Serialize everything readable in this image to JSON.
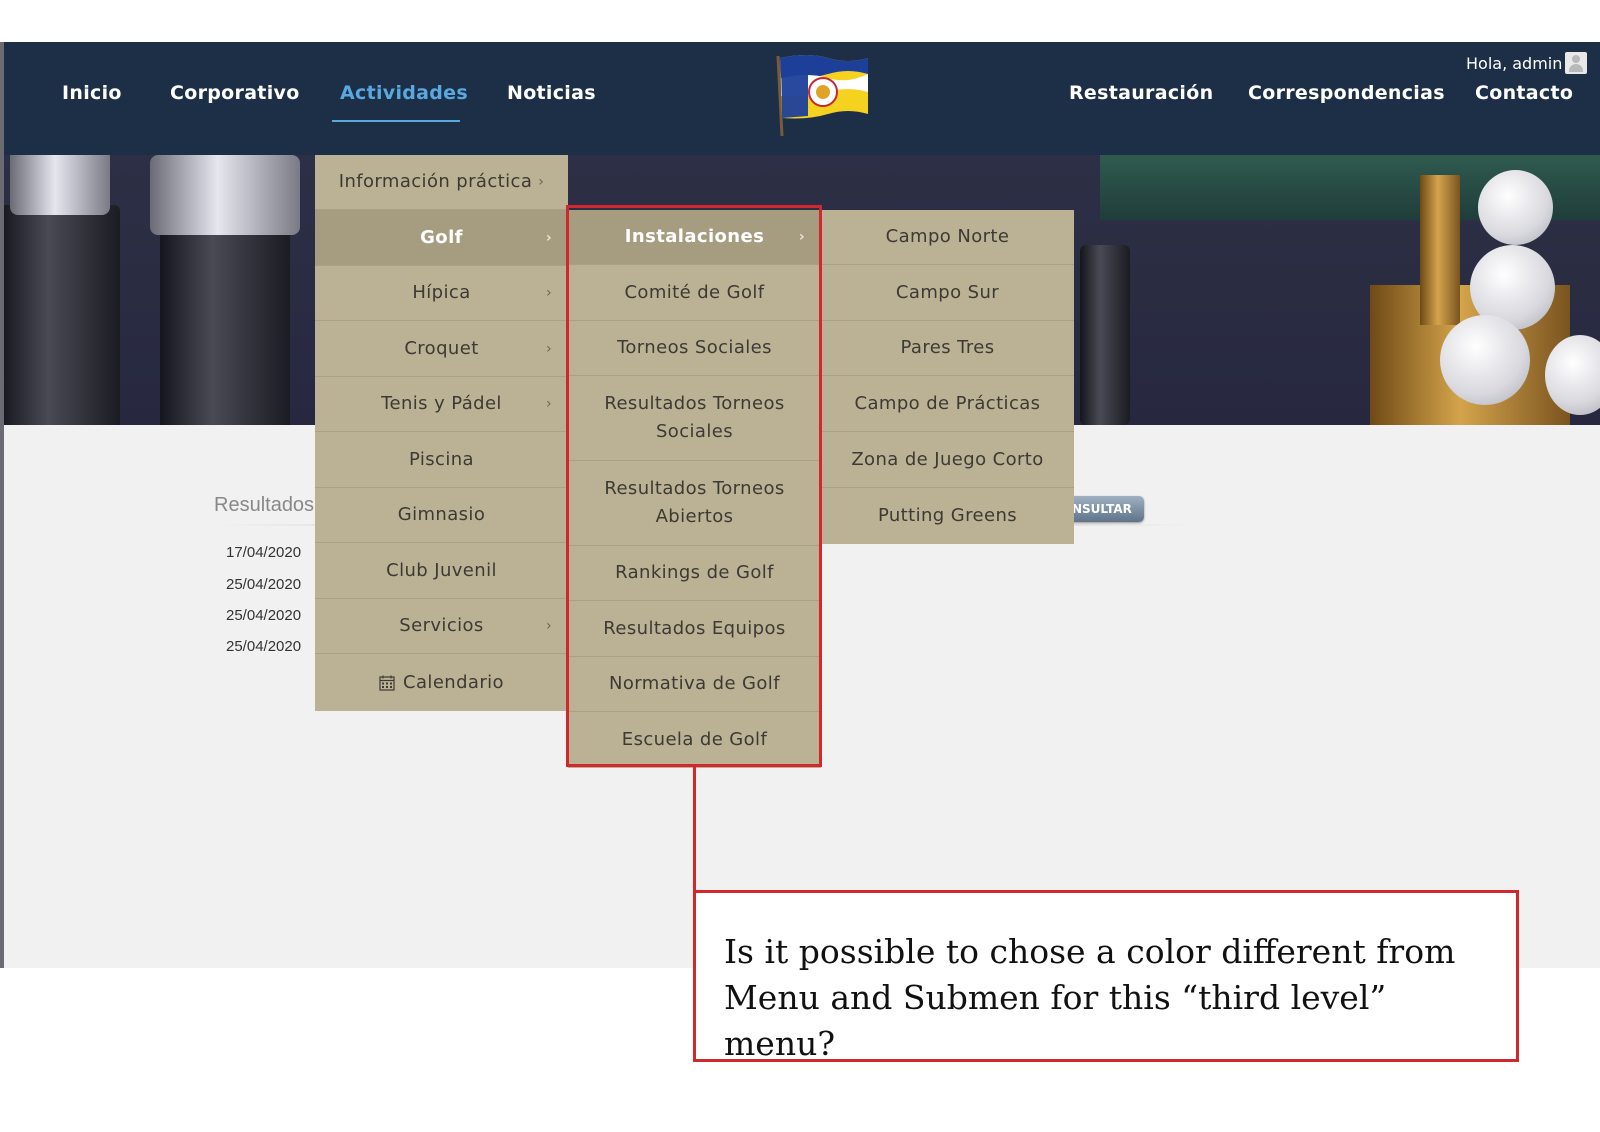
{
  "nav": {
    "left": [
      "Inicio",
      "Corporativo",
      "Actividades",
      "Noticias"
    ],
    "right": [
      "Restauración",
      "Correspondencias",
      "Contacto"
    ],
    "active": "Actividades",
    "greeting": "Hola, admin",
    "logo_text": "1901 RSHECC"
  },
  "colors": {
    "navbar": "#1d2f47",
    "active": "#5aa8e0",
    "menu": "#bbb194",
    "menu_selected": "#a69c7f",
    "highlight": "#d1282e"
  },
  "menu1": [
    {
      "label": "Información práctica",
      "has_sub": true
    },
    {
      "label": "Golf",
      "has_sub": true,
      "selected": true
    },
    {
      "label": "Hípica",
      "has_sub": true
    },
    {
      "label": "Croquet",
      "has_sub": true
    },
    {
      "label": "Tenis y Pádel",
      "has_sub": true
    },
    {
      "label": "Piscina",
      "has_sub": false
    },
    {
      "label": "Gimnasio",
      "has_sub": false
    },
    {
      "label": "Club Juvenil",
      "has_sub": false
    },
    {
      "label": "Servicios",
      "has_sub": true
    },
    {
      "label": "Calendario",
      "has_sub": false,
      "icon": "calendar-icon"
    }
  ],
  "menu2": [
    {
      "label": "Instalaciones",
      "has_sub": true,
      "selected": true
    },
    {
      "label": "Comité de Golf"
    },
    {
      "label": "Torneos Sociales"
    },
    {
      "label": "Resultados Torneos Sociales"
    },
    {
      "label": "Resultados Torneos Abiertos"
    },
    {
      "label": "Rankings de Golf"
    },
    {
      "label": "Resultados Equipos"
    },
    {
      "label": "Normativa de Golf"
    },
    {
      "label": "Escuela de Golf"
    }
  ],
  "menu3": [
    {
      "label": "Campo Norte"
    },
    {
      "label": "Campo Sur"
    },
    {
      "label": "Pares Tres"
    },
    {
      "label": "Campo de Prácticas"
    },
    {
      "label": "Zona de Juego Corto"
    },
    {
      "label": "Putting Greens"
    }
  ],
  "results": {
    "title": "Resultados",
    "dates": [
      "17/04/2020",
      "25/04/2020",
      "25/04/2020",
      "25/04/2020"
    ],
    "button": "NSULTAR"
  },
  "callout": {
    "text": "Is it possible to chose a color different from Menu and Submen for this “third level” menu?"
  }
}
